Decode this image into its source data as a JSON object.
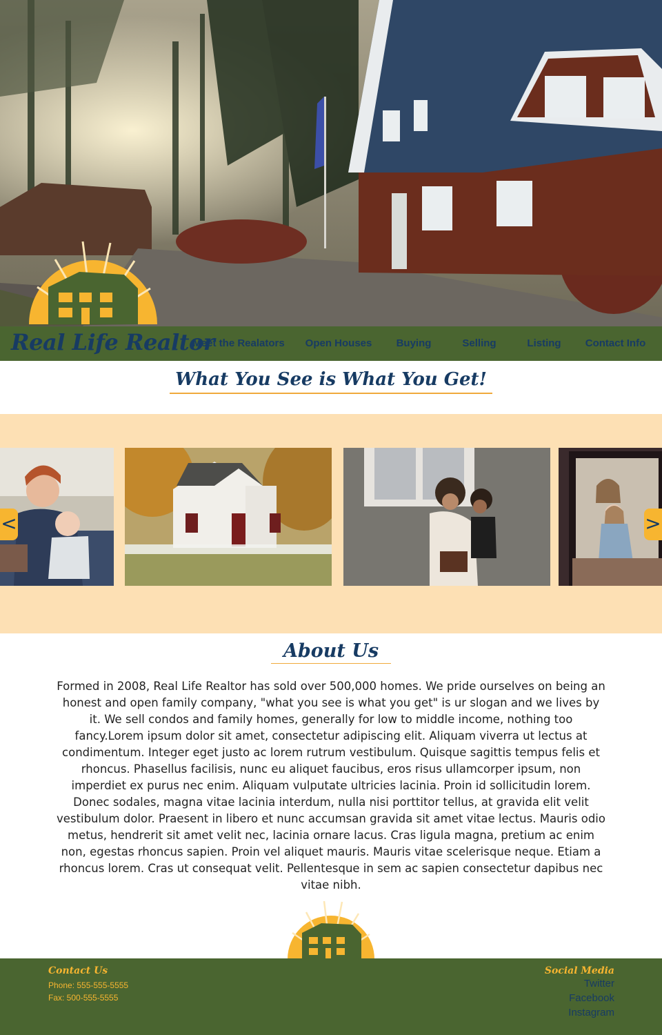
{
  "brand": {
    "name": "Real Life Realtor"
  },
  "nav": {
    "items": [
      {
        "label": "Meet the Realators"
      },
      {
        "label": "Open Houses"
      },
      {
        "label": "Buying"
      },
      {
        "label": "Selling"
      },
      {
        "label": "Listing"
      },
      {
        "label": "Contact Info"
      }
    ]
  },
  "headline": "What You See is What You Get!",
  "carousel": {
    "prev_label": "<",
    "next_label": ">",
    "slides": [
      {
        "subject": "mother-with-baby-photo"
      },
      {
        "subject": "white-house-photo"
      },
      {
        "subject": "mother-and-daughter-photo"
      },
      {
        "subject": "girls-in-mirror-photo"
      }
    ]
  },
  "about": {
    "title": "About Us",
    "body": "Formed in 2008, Real Life Realtor has sold over 500,000 homes. We pride ourselves on being an honest and open family company, \"what you see is what you get\" is ur slogan and we lives by it. We sell condos and family homes, generally for low to middle income, nothing too fancy.Lorem ipsum dolor sit amet, consectetur adipiscing elit. Aliquam viverra ut lectus at condimentum. Integer eget justo ac lorem rutrum vestibulum. Quisque sagittis tempus felis et rhoncus. Phasellus facilisis, nunc eu aliquet faucibus, eros risus ullamcorper ipsum, non imperdiet ex purus nec enim. Aliquam vulputate ultricies lacinia. Proin id sollicitudin lorem. Donec sodales, magna vitae lacinia interdum, nulla nisi porttitor tellus, at gravida elit velit vestibulum dolor. Praesent in libero et nunc accumsan gravida sit amet vitae lectus. Mauris odio metus, hendrerit sit amet velit nec, lacinia ornare lacus. Cras ligula magna, pretium ac enim non, egestas rhoncus sapien. Proin vel aliquet mauris. Mauris vitae scelerisque neque. Etiam a rhoncus lorem. Cras ut consequat velit. Pellentesque in sem ac sapien consectetur dapibus nec vitae nibh."
  },
  "footer": {
    "contact": {
      "heading": "Contact Us",
      "phone": "Phone: 555-555-5555",
      "fax": "Fax: 500-555-5555"
    },
    "social": {
      "heading": "Social Media",
      "links": [
        "Twitter",
        "Facebook",
        "Instagram"
      ]
    }
  },
  "colors": {
    "nav_green": "#4a6530",
    "navy": "#173b63",
    "accent_orange": "#f7b530",
    "carousel_bg": "#fde0b4"
  },
  "icons": {
    "logo": "sun-house-logo",
    "prev": "chevron-left-icon",
    "next": "chevron-right-icon"
  }
}
